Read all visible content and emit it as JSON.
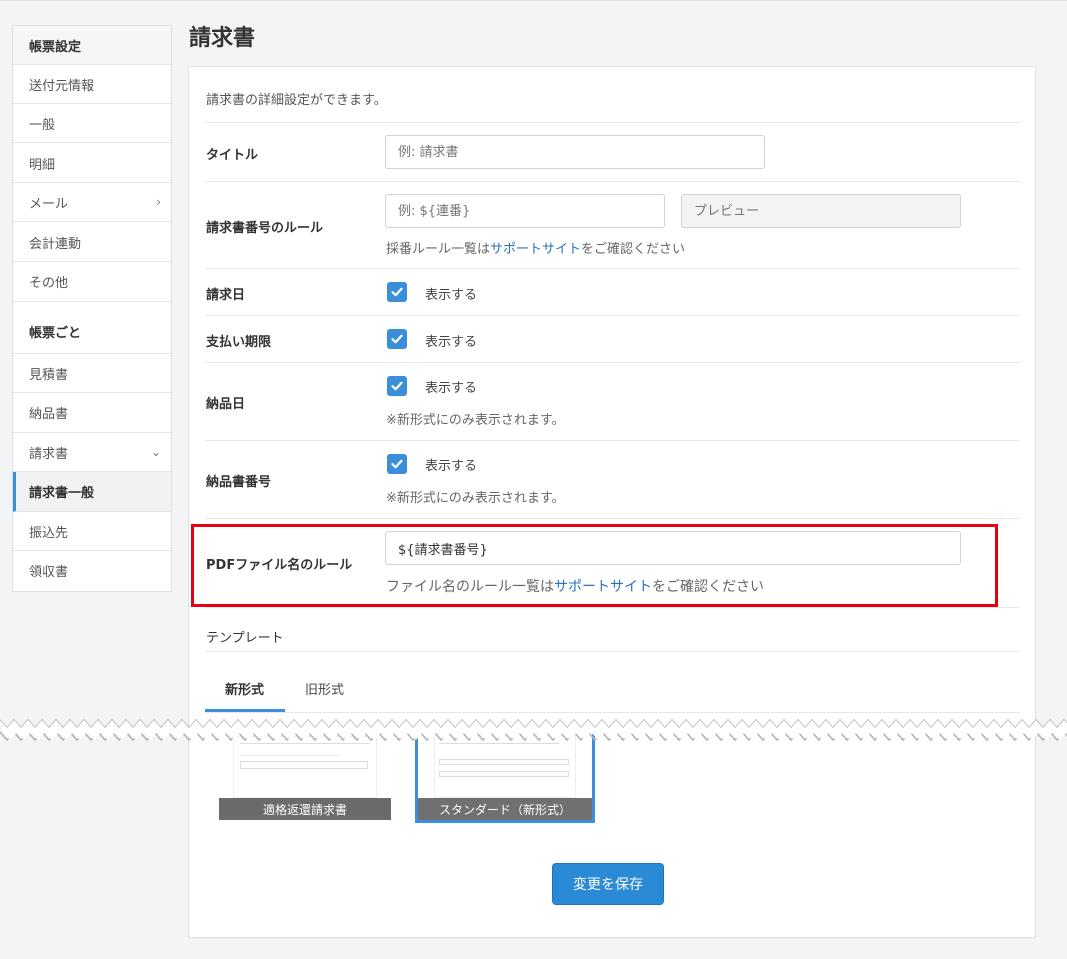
{
  "sidebar": {
    "items": [
      {
        "label": "帳票設定",
        "kind": "head"
      },
      {
        "label": "送付元情報",
        "kind": "item"
      },
      {
        "label": "一般",
        "kind": "item"
      },
      {
        "label": "明細",
        "kind": "item"
      },
      {
        "label": "メール",
        "kind": "item",
        "chevron": "›"
      },
      {
        "label": "会計連動",
        "kind": "item"
      },
      {
        "label": "その他",
        "kind": "item"
      },
      {
        "label": "帳票ごと",
        "kind": "section"
      },
      {
        "label": "見積書",
        "kind": "item"
      },
      {
        "label": "納品書",
        "kind": "item"
      },
      {
        "label": "請求書",
        "kind": "item",
        "chevron": "⌄"
      },
      {
        "label": "請求書一般",
        "kind": "active"
      },
      {
        "label": "振込先",
        "kind": "item"
      },
      {
        "label": "領収書",
        "kind": "item"
      }
    ]
  },
  "page": {
    "title": "請求書",
    "description": "請求書の詳細設定ができます。"
  },
  "form": {
    "title_label": "タイトル",
    "title_placeholder": "例: 請求書",
    "number_rule_label": "請求書番号のルール",
    "number_rule_placeholder": "例: ${連番}",
    "preview_placeholder": "プレビュー",
    "number_rule_help_pre": "採番ルール一覧は",
    "number_rule_help_link": "サポートサイト",
    "number_rule_help_post": "をご確認ください",
    "invoice_date_label": "請求日",
    "due_date_label": "支払い期限",
    "delivery_date_label": "納品日",
    "delivery_number_label": "納品書番号",
    "show_label": "表示する",
    "new_format_note": "※新形式にのみ表示されます。",
    "pdf_name_label": "PDFファイル名のルール",
    "pdf_name_value": "${請求書番号}",
    "pdf_help_pre": "ファイル名のルール一覧は",
    "pdf_help_link": "サポートサイト",
    "pdf_help_post": "をご確認ください"
  },
  "template": {
    "section_title": "テンプレート",
    "tabs": [
      "新形式",
      "旧形式"
    ],
    "thumbnails": [
      "適格返還請求書",
      "スタンダード（新形式）"
    ]
  },
  "actions": {
    "save_label": "変更を保存"
  },
  "colors": {
    "accent": "#3b8fd8",
    "highlight": "#e60012",
    "link": "#2a73b9"
  }
}
